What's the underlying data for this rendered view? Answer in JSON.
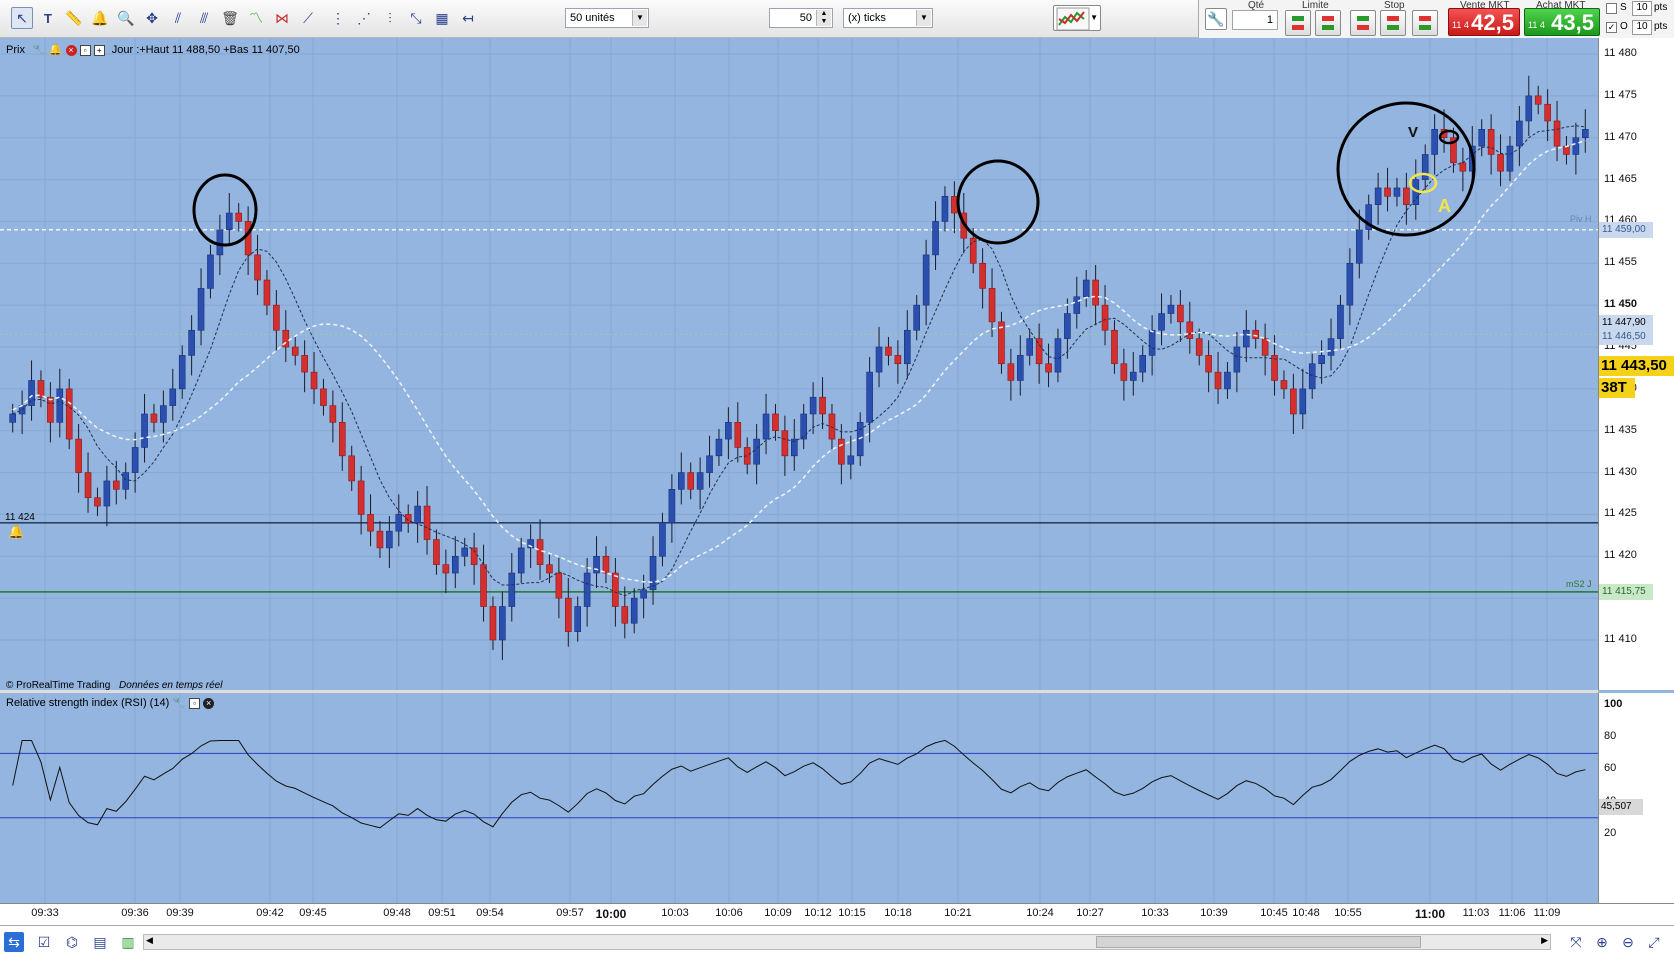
{
  "toolbar": {
    "icons": [
      "pointer-icon",
      "text-icon",
      "ruler-icon",
      "alert-bell-icon",
      "zoom-icon",
      "pan-icon",
      "line-tool-icon",
      "trash-icon",
      "pattern-icon",
      "pattern-icon",
      "trendline-icon",
      "vertical-line-icon",
      "fan-icon",
      "fibonacci-icon",
      "grid-icon",
      "arrow-icon"
    ],
    "units_select": "50 unités",
    "tick_value": "50",
    "tick_unit": "(x) ticks"
  },
  "order_panel": {
    "qty_label": "Qté",
    "qty_value": "1",
    "limit_label": "Limite",
    "stop_label": "Stop",
    "sell_label": "Vente MKT",
    "buy_label": "Achat MKT",
    "sell_prefix": "11 4",
    "sell_price": "42,5",
    "buy_prefix": "11 4",
    "buy_price": "43,5",
    "opt1_label": "S",
    "opt1_value": "10",
    "opt1_unit": "pts",
    "opt2_label": "O",
    "opt2_value": "10",
    "opt2_unit": "pts"
  },
  "price_panel": {
    "title": "Prix",
    "info": "Jour :+Haut 11 488,50 +Bas 11 407,50",
    "copyright": "© ProRealTime Trading",
    "realtime": "Données en temps réel",
    "level_left": "11 424",
    "ticks": [
      "11 480",
      "11 475",
      "11 470",
      "11 465",
      "11 460",
      "11 455",
      "11 450",
      "11 445",
      "11 440",
      "11 435",
      "11 430",
      "11 425",
      "11 420",
      "11 415",
      "11 410"
    ],
    "markers": {
      "piv_h_label": "Piv H",
      "piv_h_value": "11 459,00",
      "high": "11 447,90",
      "m1": "11 446,50",
      "current_price": "11 443,50",
      "countdown": "38T",
      "ms2_label": "mS2 J",
      "ms2_value": "11 415,75"
    },
    "annotations": {
      "v": "V",
      "a": "A"
    }
  },
  "rsi_panel": {
    "title": "Relative strength index (RSI) (14)",
    "value": "45,507",
    "ticks": [
      "100",
      "80",
      "60",
      "40",
      "20"
    ],
    "upper": 70,
    "lower": 30
  },
  "time_axis": [
    "09:33",
    "09:36",
    "09:39",
    "09:42",
    "09:45",
    "09:48",
    "09:51",
    "09:54",
    "09:57",
    "10:00",
    "10:03",
    "10:06",
    "10:09",
    "10:12",
    "10:15",
    "10:18",
    "10:21",
    "10:24",
    "10:27",
    "10:33",
    "10:39",
    "10:45",
    "10:48",
    "10:55",
    "11:00",
    "11:03",
    "11:06",
    "11:09"
  ],
  "series": {
    "closes": [
      11437,
      11438,
      11441,
      11439,
      11436,
      11440,
      11434,
      11430,
      11427,
      11426,
      11429,
      11428,
      11430,
      11433,
      11437,
      11436,
      11438,
      11440,
      11444,
      11447,
      11452,
      11456,
      11459,
      11461,
      11460,
      11456,
      11453,
      11450,
      11447,
      11445,
      11444,
      11442,
      11440,
      11438,
      11436,
      11432,
      11429,
      11425,
      11423,
      11421,
      11423,
      11425,
      11424,
      11426,
      11422,
      11419,
      11418,
      11420,
      11421,
      11419,
      11414,
      11410,
      11414,
      11418,
      11421,
      11422,
      11419,
      11418,
      11415,
      11411,
      11414,
      11418,
      11420,
      11418,
      11414,
      11412,
      11415,
      11416,
      11420,
      11424,
      11428,
      11430,
      11428,
      11430,
      11432,
      11434,
      11436,
      11433,
      11431,
      11434,
      11437,
      11435,
      11432,
      11434,
      11437,
      11439,
      11437,
      11434,
      11431,
      11432,
      11436,
      11442,
      11445,
      11444,
      11443,
      11447,
      11450,
      11456,
      11460,
      11463,
      11461,
      11458,
      11455,
      11452,
      11448,
      11443,
      11441,
      11444,
      11446,
      11443,
      11442,
      11446,
      11449,
      11451,
      11453,
      11450,
      11447,
      11443,
      11441,
      11442,
      11444,
      11447,
      11449,
      11450,
      11448,
      11446,
      11444,
      11442,
      11440,
      11442,
      11445,
      11447,
      11446,
      11444,
      11441,
      11440,
      11437,
      11440,
      11443,
      11444,
      11446,
      11450,
      11455,
      11459,
      11462,
      11464,
      11463,
      11464,
      11462,
      11465,
      11468,
      11471,
      11470,
      11467,
      11466,
      11469,
      11471,
      11468,
      11466,
      11469,
      11472,
      11475,
      11474,
      11472,
      11469,
      11468,
      11470,
      11471
    ]
  },
  "statusbar": {
    "icons": [
      "share-icon",
      "checklist-icon",
      "glasses-icon",
      "list-icon",
      "chart-list-icon"
    ],
    "right_icons": [
      "cursor-icon",
      "zoom-in-icon",
      "zoom-out-icon",
      "magnify-icon",
      "expand-icon"
    ]
  }
}
